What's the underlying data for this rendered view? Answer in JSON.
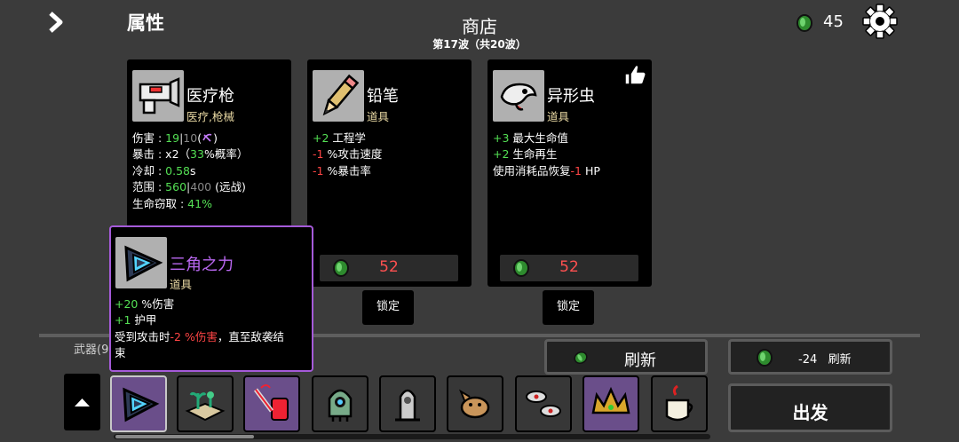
{
  "header": {
    "attributes_label": "属性",
    "shop_title": "商店",
    "wave_text": "第17波（共20波）",
    "materials": "45"
  },
  "cards": [
    {
      "name": "医疗枪",
      "type": "医疗,枪械",
      "icon": "medical-gun-icon",
      "stats": {
        "damage_label": "伤害 : ",
        "damage_value": "19",
        "damage_sep": "|",
        "damage_base": "10",
        "damage_scale_open": "(",
        "damage_scale_close": ")",
        "crit_label": "暴击 : ",
        "crit_mult": "x2（",
        "crit_pct": "33",
        "crit_tail": "%概率）",
        "cooldown_label": "冷却 : ",
        "cooldown_value": "0.58",
        "cooldown_unit": "s",
        "range_label": "范围 : ",
        "range_value": "560",
        "range_sep": "|",
        "range_base": "400",
        "range_tail": " (远战)",
        "lifesteal_label": "生命窃取 : ",
        "lifesteal_value": "41%"
      }
    },
    {
      "name": "铅笔",
      "type": "道具",
      "icon": "pencil-icon",
      "effects": [
        {
          "value": "+2",
          "text": " 工程学",
          "color": "green"
        },
        {
          "value": "-1",
          "text": " %攻击速度",
          "color": "red"
        },
        {
          "value": "-1",
          "text": " %暴击率",
          "color": "red"
        }
      ],
      "price": "52",
      "lock_label": "锁定"
    },
    {
      "name": "异形虫",
      "type": "道具",
      "icon": "alien-worm-icon",
      "effects": [
        {
          "value": "+3",
          "text": " 最大生命值",
          "color": "green"
        },
        {
          "value": "+2",
          "text": " 生命再生",
          "color": "green"
        }
      ],
      "effect_extra_prefix": "使用消耗品恢复",
      "effect_extra_value": "-1",
      "effect_extra_suffix": " HP",
      "price": "52",
      "lock_label": "锁定",
      "recommended_icon": "thumbs-up-icon"
    }
  ],
  "tooltip": {
    "name": "三角之力",
    "type": "道具",
    "icon": "triangle-of-power-icon",
    "line1_value": "+20",
    "line1_text": " %伤害",
    "line2_value": "+1",
    "line2_text": " 护甲",
    "line3_prefix": "受到攻击时",
    "line3_value": "-2 %伤害",
    "line3_suffix": "，直至敌袭结",
    "line4": "束"
  },
  "weapons_label": "武器(9",
  "refresh": {
    "label": "刷新"
  },
  "reroll_cost": {
    "value": "-24",
    "label": "刷新"
  },
  "go": {
    "label": "出发"
  },
  "inventory": [
    {
      "icon": "triangle-of-power-icon",
      "tier": "legendary",
      "selected": true
    },
    {
      "icon": "garden-icon",
      "tier": "common"
    },
    {
      "icon": "blood-bag-syringe-icon",
      "tier": "rare"
    },
    {
      "icon": "alien-pod-icon",
      "tier": "uncommon"
    },
    {
      "icon": "rocket-statue-icon",
      "tier": "common"
    },
    {
      "icon": "pet-dog-icon",
      "tier": "common"
    },
    {
      "icon": "spinning-tops-icon",
      "tier": "common"
    },
    {
      "icon": "spiked-crown-icon",
      "tier": "legendary"
    },
    {
      "icon": "coffee-cup-icon",
      "tier": "common"
    }
  ],
  "colors": {
    "background": "#3b3b3b",
    "stat_positive": "#54e054",
    "stat_negative": "#ff4545",
    "legendary": "#a55ad9",
    "price": "#ff5050",
    "item_type": "#e9d9a3"
  }
}
